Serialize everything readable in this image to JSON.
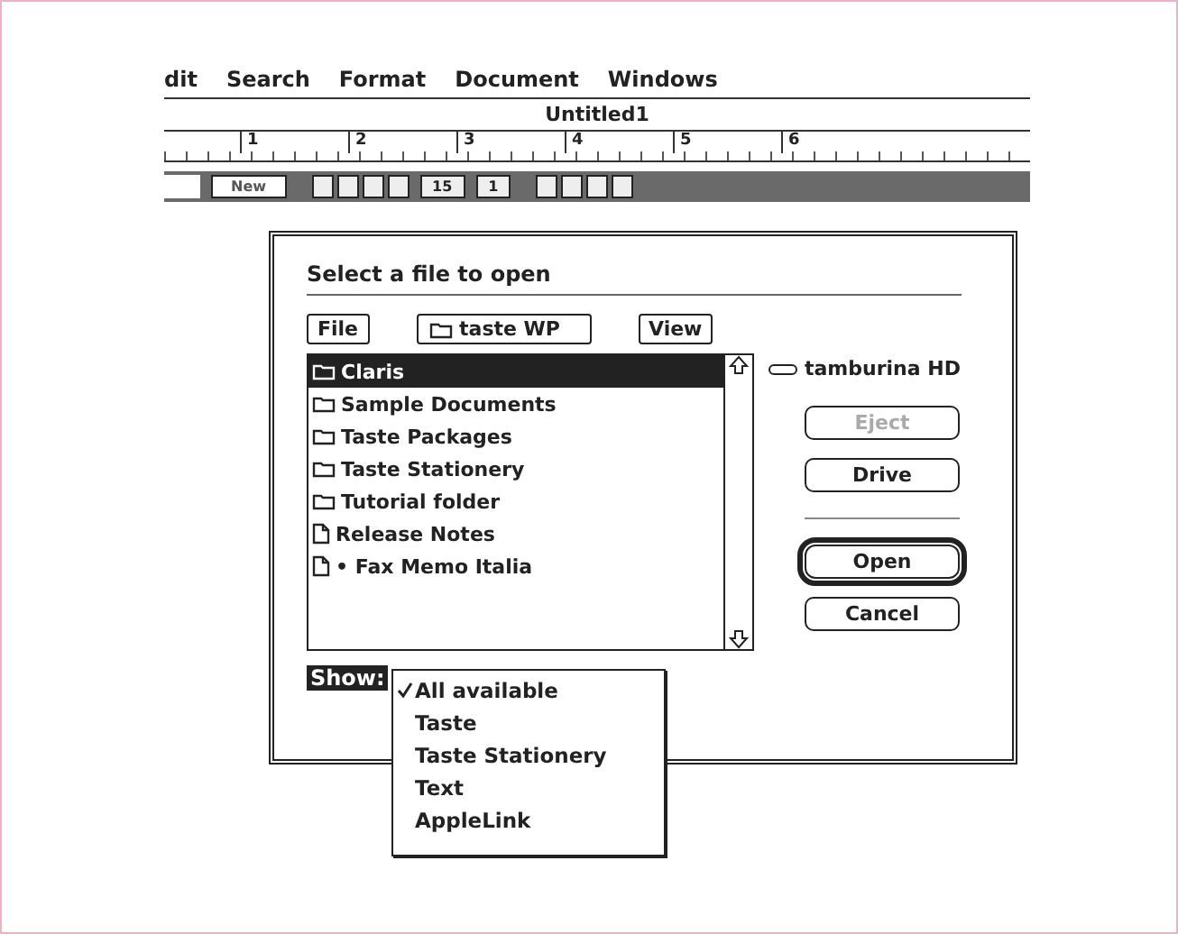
{
  "menu_bar": [
    "dit",
    "Search",
    "Format",
    "Document",
    "Windows"
  ],
  "document": {
    "title": "Untitled1"
  },
  "ruler": {
    "labels": [
      "1",
      "2",
      "3",
      "4",
      "5",
      "6"
    ]
  },
  "toolbar": {
    "new_button": "New",
    "size_field": "15",
    "spacing_field": "1"
  },
  "dialog": {
    "prompt": "Select a file to open",
    "file_button": "File",
    "folder_popup": "taste WP",
    "view_button": "View",
    "files": [
      {
        "name": "Claris",
        "kind": "folder",
        "selected": true
      },
      {
        "name": "Sample Documents",
        "kind": "folder",
        "selected": false
      },
      {
        "name": "Taste Packages",
        "kind": "folder",
        "selected": false
      },
      {
        "name": "Taste Stationery",
        "kind": "folder",
        "selected": false
      },
      {
        "name": "Tutorial folder",
        "kind": "folder",
        "selected": false
      },
      {
        "name": "Release Notes",
        "kind": "document",
        "selected": false
      },
      {
        "name": "• Fax Memo Italia",
        "kind": "document",
        "selected": false
      }
    ],
    "drive_name": "tamburina HD",
    "buttons": [
      {
        "label": "Eject",
        "disabled": true,
        "default": false
      },
      {
        "label": "Drive",
        "disabled": false,
        "default": false
      },
      {
        "label": "Open",
        "disabled": false,
        "default": true
      },
      {
        "label": "Cancel",
        "disabled": false,
        "default": false
      }
    ],
    "show_label": "Show:",
    "show_options": [
      {
        "label": "All available",
        "checked": true
      },
      {
        "label": "Taste",
        "checked": false
      },
      {
        "label": "Taste Stationery",
        "checked": false
      },
      {
        "label": "Text",
        "checked": false
      },
      {
        "label": "AppleLink",
        "checked": false
      }
    ]
  }
}
